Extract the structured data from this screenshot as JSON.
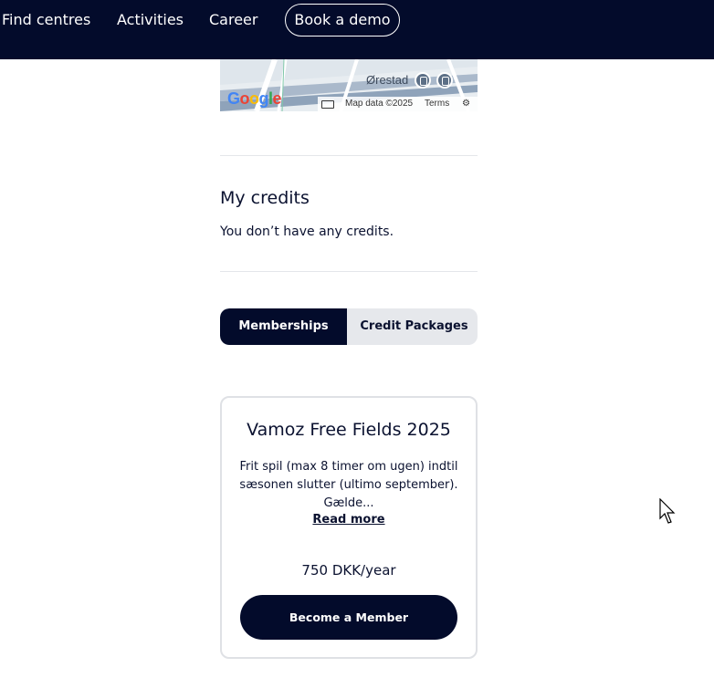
{
  "nav": {
    "items": [
      "Find centres",
      "Activities",
      "Career"
    ],
    "demo_label": "Book a demo"
  },
  "map": {
    "place": "Ørestad",
    "attribution": "Map data ©2025",
    "terms": "Terms",
    "logo": "Google",
    "icons": [
      "train-station-icon",
      "metro-station-icon",
      "keyboard-icon",
      "gear-icon"
    ]
  },
  "credits": {
    "title": "My credits",
    "empty_text": "You don’t have any credits."
  },
  "tabs": {
    "memberships": "Memberships",
    "credit_packages": "Credit Packages"
  },
  "membership_card": {
    "title": "Vamoz Free Fields 2025",
    "description": "Frit spil (max 8 timer om ugen) indtil sæsonen slutter (ultimo september). Gælde...",
    "read_more": "Read more",
    "price": "750 DKK/year",
    "cta": "Become a Member"
  },
  "colors": {
    "navy": "#030b2b",
    "tab_bg": "#e6e8ec",
    "border": "#dfe1e5"
  }
}
